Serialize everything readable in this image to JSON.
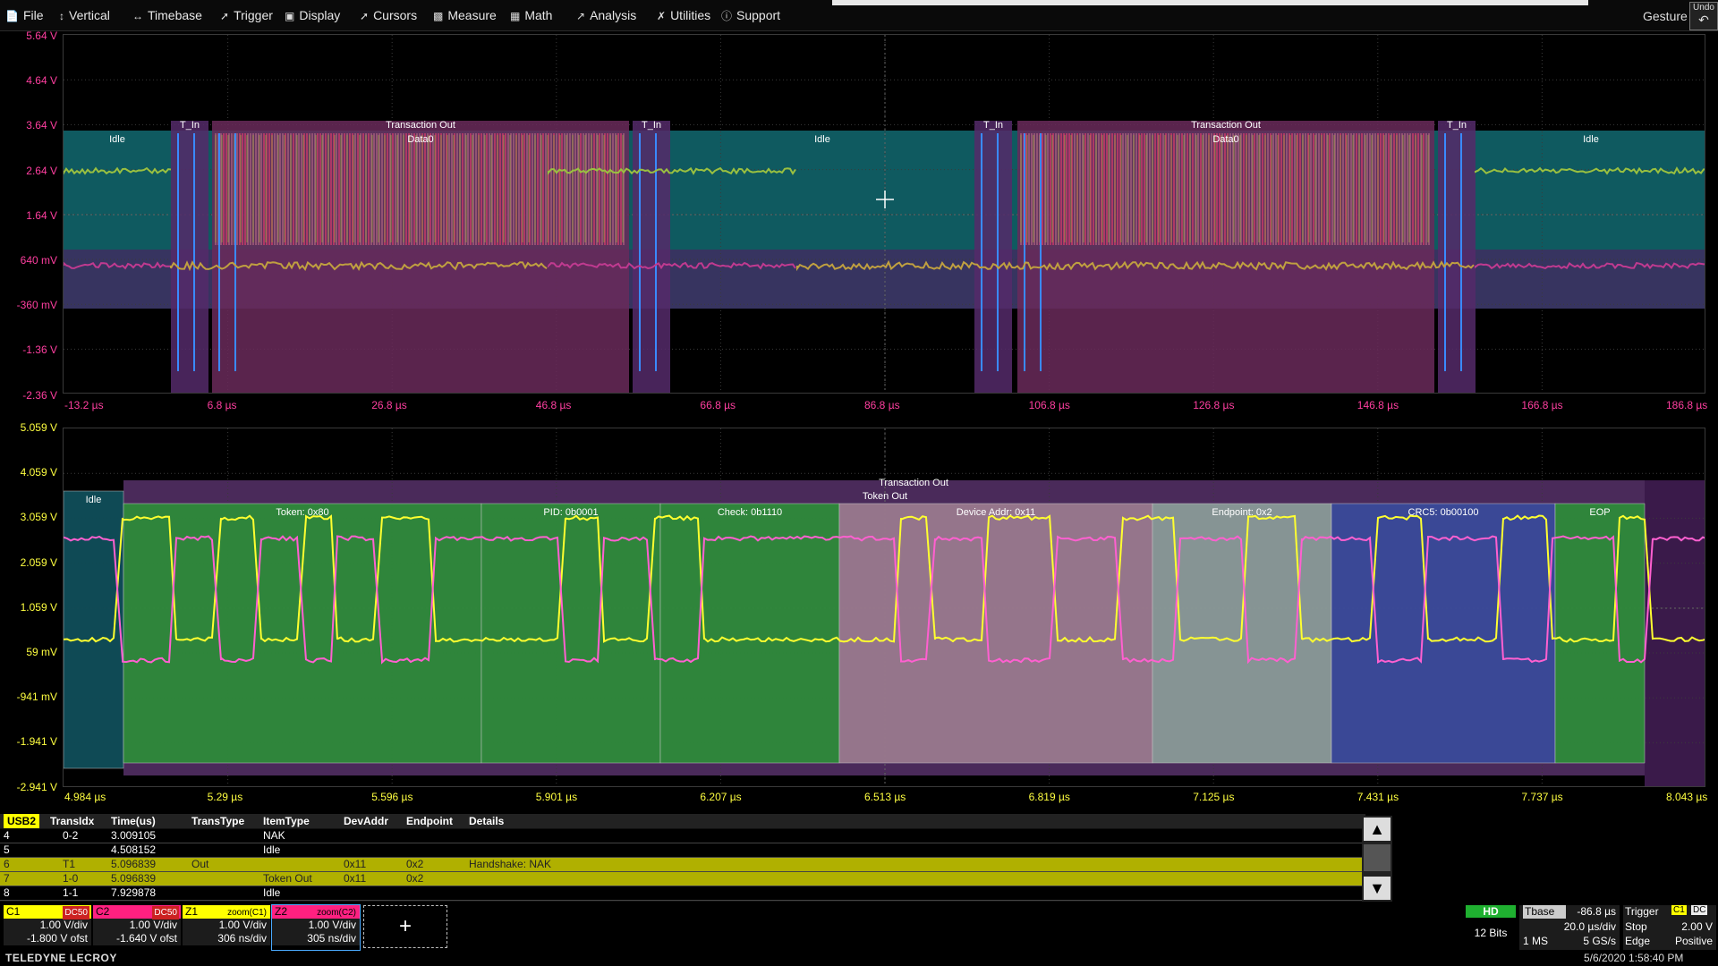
{
  "menu": {
    "items": [
      {
        "label": "File",
        "icon": "file-icon"
      },
      {
        "label": "Vertical",
        "icon": "vertical-icon"
      },
      {
        "label": "Timebase",
        "icon": "timebase-icon"
      },
      {
        "label": "Trigger",
        "icon": "trigger-icon"
      },
      {
        "label": "Display",
        "icon": "display-icon"
      },
      {
        "label": "Cursors",
        "icon": "cursors-icon"
      },
      {
        "label": "Measure",
        "icon": "measure-icon"
      },
      {
        "label": "Math",
        "icon": "math-icon"
      },
      {
        "label": "Analysis",
        "icon": "analysis-icon"
      },
      {
        "label": "Utilities",
        "icon": "utilities-icon"
      },
      {
        "label": "Support",
        "icon": "support-icon"
      }
    ],
    "gesture": "Gesture",
    "undo": "Undo"
  },
  "top_grid": {
    "y_labels": [
      "5.64 V",
      "4.64 V",
      "3.64 V",
      "2.64 V",
      "1.64 V",
      "640 mV",
      "-360 mV",
      "-1.36 V",
      "-2.36 V"
    ],
    "x_labels": [
      "-13.2 µs",
      "6.8 µs",
      "26.8 µs",
      "46.8 µs",
      "66.8 µs",
      "86.8 µs",
      "106.8 µs",
      "126.8 µs",
      "146.8 µs",
      "166.8 µs",
      "186.8 µs"
    ],
    "segments": [
      {
        "label": "Idle",
        "top": "",
        "l": 70,
        "r": 190
      },
      {
        "label": "",
        "top": "T_In",
        "l": 190,
        "r": 232
      },
      {
        "label": "Data0",
        "top": "Transaction Out",
        "l": 236,
        "r": 702
      },
      {
        "label": "",
        "top": "T_In",
        "l": 706,
        "r": 748
      },
      {
        "label": "Idle",
        "top": "",
        "l": 748,
        "r": 1088
      },
      {
        "label": "",
        "top": "T_In",
        "l": 1088,
        "r": 1130
      },
      {
        "label": "Data0",
        "top": "Transaction Out",
        "l": 1136,
        "r": 1602
      },
      {
        "label": "",
        "top": "T_In",
        "l": 1606,
        "r": 1648
      },
      {
        "label": "Idle",
        "top": "",
        "l": 1648,
        "r": 1906
      }
    ]
  },
  "bottom_grid": {
    "y_labels": [
      "5.059 V",
      "4.059 V",
      "3.059 V",
      "2.059 V",
      "1.059 V",
      "59 mV",
      "-941 mV",
      "-1.941 V",
      "-2.941 V"
    ],
    "x_labels": [
      "4.984 µs",
      "5.29 µs",
      "5.596 µs",
      "5.901 µs",
      "6.207 µs",
      "6.513 µs",
      "6.819 µs",
      "7.125 µs",
      "7.431 µs",
      "7.737 µs",
      "8.043 µs"
    ],
    "transaction_label": "Transaction Out",
    "token_label": "Token Out",
    "segments": [
      {
        "label": "Idle",
        "color": "#0f4a55",
        "l": 70,
        "r": 137
      },
      {
        "label": "Token: 0x80",
        "color": "#2e8a3a",
        "l": 137,
        "r": 537
      },
      {
        "label": "PID: 0b0001",
        "color": "#2e8a3a",
        "l": 537,
        "r": 737
      },
      {
        "label": "Check: 0b1110",
        "color": "#2e8a3a",
        "l": 737,
        "r": 937
      },
      {
        "label": "Device Addr: 0x11",
        "color": "#9a7a8e",
        "l": 937,
        "r": 1287
      },
      {
        "label": "Endpoint: 0x2",
        "color": "#8a9a98",
        "l": 1287,
        "r": 1487
      },
      {
        "label": "CRC5: 0b00100",
        "color": "#3a4a9a",
        "l": 1487,
        "r": 1737
      },
      {
        "label": "EOP",
        "color": "#2e8a3a",
        "l": 1737,
        "r": 1837
      }
    ]
  },
  "table": {
    "headers": [
      "USB2",
      "TransIdx",
      "Time(us)",
      "TransType",
      "ItemType",
      "DevAddr",
      "Endpoint",
      "Details"
    ],
    "rows": [
      {
        "idx": "4",
        "trans": "0-2",
        "time": "3.009105",
        "ttype": "",
        "itype": "NAK",
        "dev": "",
        "ep": "",
        "det": "",
        "style": "dk"
      },
      {
        "idx": "5",
        "trans": "",
        "time": "4.508152",
        "ttype": "",
        "itype": "Idle",
        "dev": "",
        "ep": "",
        "det": "",
        "style": "dk"
      },
      {
        "idx": "6",
        "trans": "T1",
        "time": "5.096839",
        "ttype": "Out",
        "itype": "",
        "dev": "0x11",
        "ep": "0x2",
        "det": "Handshake: NAK",
        "style": "hl"
      },
      {
        "idx": "7",
        "trans": "1-0",
        "time": "5.096839",
        "ttype": "",
        "itype": "Token Out",
        "dev": "0x11",
        "ep": "0x2",
        "det": "",
        "style": "hl"
      },
      {
        "idx": "8",
        "trans": "1-1",
        "time": "7.929878",
        "ttype": "",
        "itype": "Idle",
        "dev": "",
        "ep": "",
        "det": "",
        "style": "dk"
      }
    ]
  },
  "channels": [
    {
      "name": "C1",
      "tag": "DC50",
      "color": "#ffff00",
      "v1": "1.00 V/div",
      "v2": "-1.800 V ofst"
    },
    {
      "name": "C2",
      "tag": "DC50",
      "color": "#ff2080",
      "v1": "1.00 V/div",
      "v2": "-1.640 V ofst"
    },
    {
      "name": "Z1",
      "tag": "zoom(C1)",
      "color": "#ffff00",
      "v1": "1.00 V/div",
      "v2": "306 ns/div"
    },
    {
      "name": "Z2",
      "tag": "zoom(C2)",
      "color": "#ff2080",
      "v1": "1.00 V/div",
      "v2": "305 ns/div"
    }
  ],
  "add_button": "+",
  "status": {
    "hd": "HD",
    "bits": "12 Bits",
    "tbase_label": "Tbase",
    "tbase_val": "-86.8 µs",
    "tdiv": "20.0 µs/div",
    "ms": "1 MS",
    "rate": "5 GS/s",
    "trigger_label": "Trigger",
    "trigger_ch": "C1",
    "trigger_dc": "DC",
    "stop": "Stop",
    "level": "2.00 V",
    "edge": "Edge",
    "slope": "Positive"
  },
  "footer": {
    "brand": "TELEDYNE LECROY",
    "datetime": "5/6/2020 1:58:40 PM"
  },
  "colors": {
    "c1": "#ffff30",
    "c2": "#ff3fa0",
    "teal": "#0f5a60",
    "purple": "#5a2a6a"
  }
}
